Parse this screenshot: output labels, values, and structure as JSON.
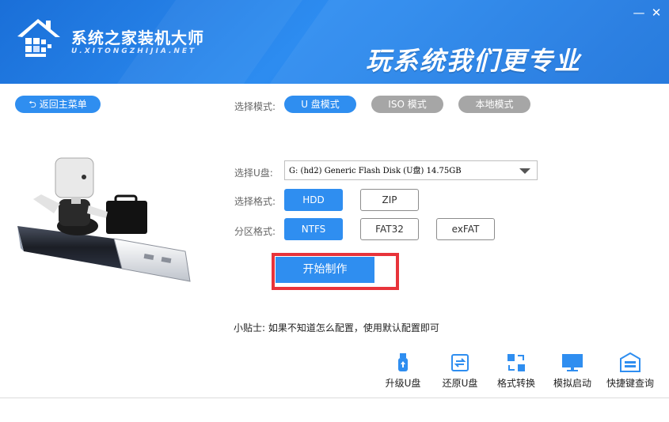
{
  "header": {
    "brand_name": "系统之家装机大师",
    "brand_url": "U.XITONGZHIJIA.NET",
    "slogan": "玩系统我们更专业",
    "min_symbol": "—",
    "close_symbol": "✕"
  },
  "back_button": {
    "icon": "return-arrow-icon",
    "label": "返回主菜单"
  },
  "mode": {
    "label": "选择模式:",
    "options": [
      "U 盘模式",
      "ISO 模式",
      "本地模式"
    ],
    "selected": "U 盘模式"
  },
  "usb": {
    "label": "选择U盘:",
    "selected": "G: (hd2) Generic Flash Disk  (U盘) 14.75GB"
  },
  "format": {
    "label": "选择格式:",
    "options": [
      "HDD",
      "ZIP"
    ],
    "selected": "HDD"
  },
  "partition": {
    "label": "分区格式:",
    "options": [
      "NTFS",
      "FAT32",
      "exFAT"
    ],
    "selected": "NTFS"
  },
  "start_button": {
    "label": "开始制作"
  },
  "tip": "小贴士: 如果不知道怎么配置，使用默认配置即可",
  "tools": [
    {
      "icon": "usb-upgrade-icon",
      "label": "升级U盘"
    },
    {
      "icon": "usb-restore-icon",
      "label": "还原U盘"
    },
    {
      "icon": "format-convert-icon",
      "label": "格式转换"
    },
    {
      "icon": "monitor-simulate-icon",
      "label": "模拟启动"
    },
    {
      "icon": "shortcut-key-icon",
      "label": "快捷键查询"
    }
  ],
  "colors": {
    "accent": "#2f8ef0",
    "header": "#1e78e0",
    "highlight": "#e8333a",
    "inactive": "#a6a6a6"
  }
}
